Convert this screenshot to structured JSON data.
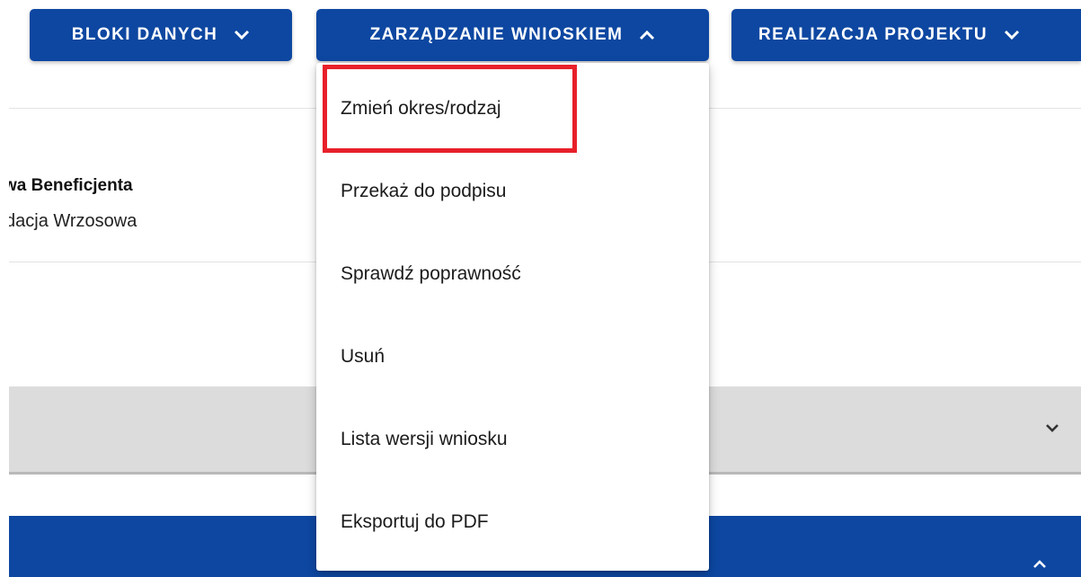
{
  "toolbar": {
    "bloki_danych": "BLOKI DANYCH",
    "zarzadzanie_wnioskiem": "ZARZĄDZANIE WNIOSKIEM",
    "realizacja_projektu": "REALIZACJA PROJEKTU"
  },
  "field": {
    "label": "wa Beneficjenta",
    "value": "dacja Wrzosowa"
  },
  "menu": {
    "items": [
      "Zmień okres/rodzaj",
      "Przekaż do podpisu",
      "Sprawdź poprawność",
      "Usuń",
      "Lista wersji wniosku",
      "Eksportuj do PDF"
    ],
    "highlighted_item": "Zmień okres/rodzaj"
  },
  "colors": {
    "primary": "#0d47a1",
    "highlight_border": "#e8202a",
    "panel_grey": "#dcdcdc"
  },
  "icons": {
    "toolbar_bloki": "chevron-down-icon",
    "toolbar_zarzadzanie": "chevron-up-icon",
    "toolbar_realizacja": "chevron-down-icon",
    "grey_panel": "chevron-down-icon",
    "blue_bar": "chevron-up-icon"
  }
}
